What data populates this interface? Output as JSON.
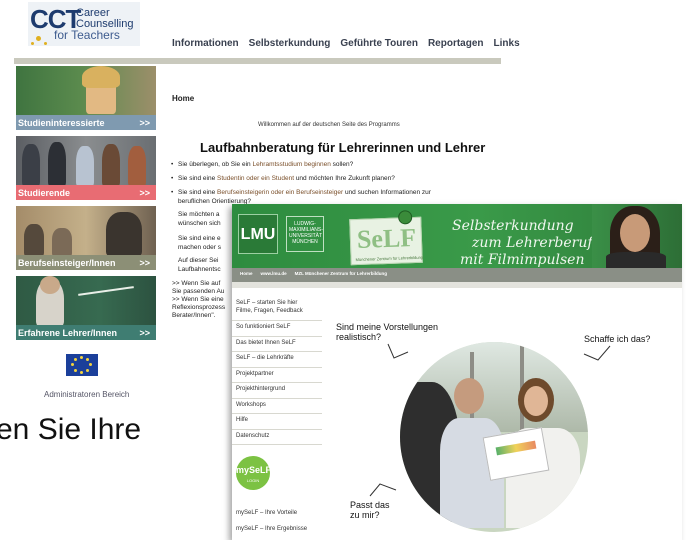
{
  "cct": {
    "logo_big": "CCT",
    "logo_line1": "Career",
    "logo_line2": "Counselling",
    "logo_line3": "for Teachers",
    "nav": [
      "Informationen",
      "Selbsterkundung",
      "Geführte Touren",
      "Reportagen",
      "Links"
    ],
    "sidebar": [
      {
        "label": "Studieninteressierte",
        "arrow": ">>",
        "color": "#7f9ab0"
      },
      {
        "label": "Studierende",
        "arrow": ">>",
        "color": "#e86c73"
      },
      {
        "label": "Berufseinsteiger/Innen",
        "arrow": ">>",
        "color": "#8c8f76"
      },
      {
        "label": "Erfahrene Lehrer/Innen",
        "arrow": ">>",
        "color": "#3f7d72"
      }
    ],
    "admin": "Administratoren Bereich",
    "home": "Home",
    "welcome": "Willkommen auf der deutschen Seite des Programms",
    "heading": "Laufbahnberatung für Lehrerinnen und Lehrer",
    "bullets": [
      {
        "pre": "Sie überlegen, ob Sie ein ",
        "link": "Lehramtsstudium beginnen",
        "post": " sollen?"
      },
      {
        "pre": "Sie sind eine ",
        "link": "Studentin oder ein Student",
        "post": " und möchten Ihre Zukunft planen?"
      },
      {
        "pre": "Sie sind eine ",
        "link": "Berufseinsteigerin oder ein Berufseinsteiger",
        "post": " und suchen Informationen zur",
        "line2": "beruflichen Orientierung?"
      },
      {
        "pre": "Sie möchten a",
        "link": "",
        "post": "",
        "line2": "wünschen sich"
      },
      {
        "pre": "Sie sind eine e",
        "link": "",
        "post": "",
        "line2": "machen oder s"
      },
      {
        "pre": "Auf dieser Sei",
        "link": "",
        "post": "",
        "line2": "Laufbahnentsc"
      }
    ],
    "more_lines": [
      ">> Wenn Sie auf",
      "Sie passenden Au",
      ">> Wenn Sie eine",
      "Reflexionsprozess",
      "Berater/Innen\"."
    ],
    "big_text": "en Sie Ihre"
  },
  "self": {
    "lmu": "LMU",
    "lmu_text": [
      "LUDWIG-",
      "MAXIMILIANS-",
      "UNIVERSITÄT",
      "MÜNCHEN"
    ],
    "logo": "SeLF",
    "logo_sub": "Münchener Zentrum für Lehrerbildung",
    "tagline": [
      "Selbsterkundung",
      "zum Lehrerberuf",
      "mit Filmimpulsen"
    ],
    "topnav": [
      "Home",
      "www.lmu.de",
      "MZL Münchener Zentrum für Lehrerbildung"
    ],
    "menu_first": [
      "SeLF – starten Sie hier",
      "Filme, Fragen, Feedback"
    ],
    "menu": [
      "So funktioniert SeLF",
      "Das bietet Ihnen SeLF",
      "SeLF – die Lehrkräfte",
      "Projektpartner",
      "Projekthintergrund",
      "Workshops",
      "Hilfe",
      "Datenschutz"
    ],
    "myself": "mySeLF",
    "login": "LOGIN",
    "myself_links": [
      "mySeLF – Ihre Vorteile",
      "mySeLF – Ihre Ergebnisse"
    ],
    "q1": [
      "Sind meine Vorstellungen",
      "realistisch?"
    ],
    "q2": "Schaffe ich das?",
    "q3": [
      "Passt das",
      "zu mir?"
    ]
  }
}
